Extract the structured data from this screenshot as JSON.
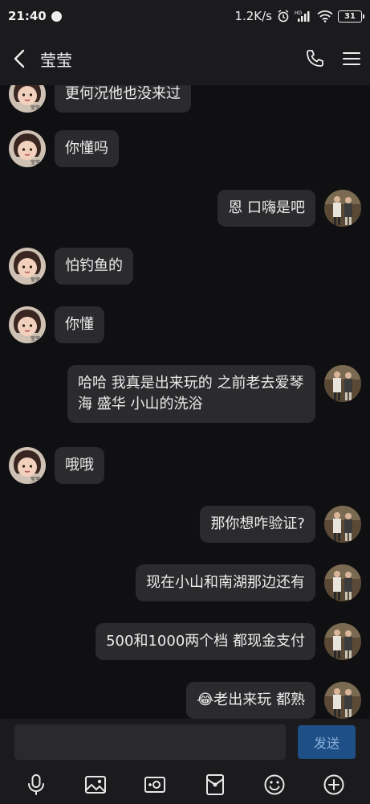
{
  "status_bar": {
    "time": "21:40",
    "network_speed": "1.2K/s",
    "battery": "31"
  },
  "header": {
    "title": "莹莹"
  },
  "messages": [
    {
      "dir": "in",
      "text": "更何况他也没来过"
    },
    {
      "dir": "in",
      "text": "你懂吗"
    },
    {
      "dir": "out",
      "text": "恩 口嗨是吧"
    },
    {
      "dir": "in",
      "text": "怕钓鱼的"
    },
    {
      "dir": "in",
      "text": "你懂"
    },
    {
      "dir": "out",
      "text": "哈哈 我真是出来玩的 之前老去爱琴海 盛华 小山的洗浴"
    },
    {
      "dir": "in",
      "text": "哦哦"
    },
    {
      "dir": "out",
      "text": "那你想咋验证?"
    },
    {
      "dir": "out",
      "text": "现在小山和南湖那边还有"
    },
    {
      "dir": "out",
      "text": "500和1000两个档 都现金支付"
    },
    {
      "dir": "out",
      "text": "😂老出来玩 都熟"
    }
  ],
  "input": {
    "placeholder": "",
    "send_label": "发送"
  },
  "toolbar": [
    "microphone-icon",
    "image-icon",
    "camera-icon",
    "red-packet-icon",
    "emoji-icon",
    "plus-icon"
  ],
  "colors": {
    "background": "#101013",
    "bar": "#1b1b1e",
    "bubble": "#2b2b2e",
    "send_button": "#1e4f86"
  }
}
